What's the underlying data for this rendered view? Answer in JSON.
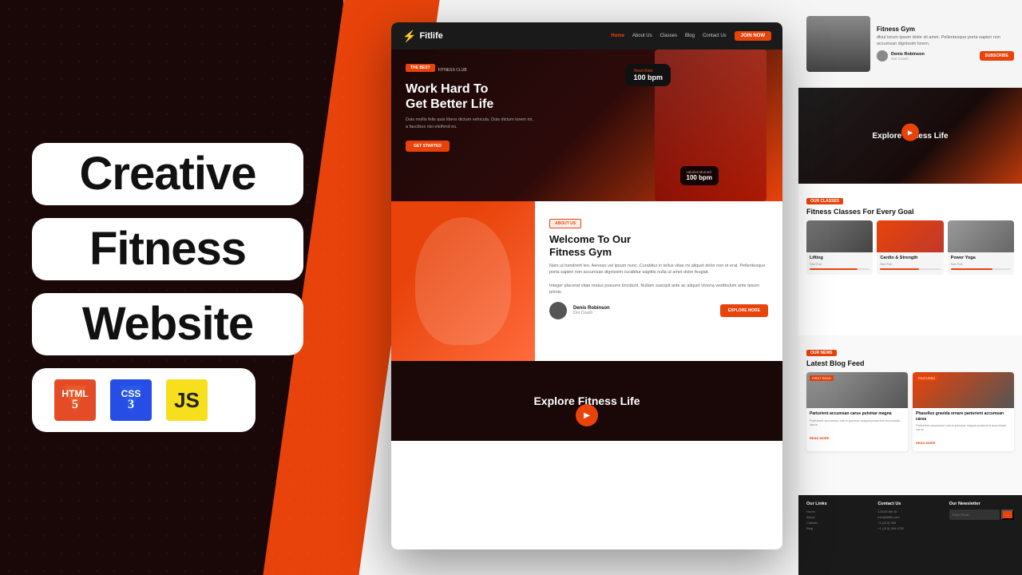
{
  "left": {
    "badge1": "Creative",
    "badge2": "Fitness",
    "badge3": "Website",
    "tech": {
      "html": "HTML5",
      "css": "CSS3",
      "js": "JS"
    }
  },
  "mockup": {
    "nav": {
      "logo": "Fitlife",
      "links": [
        "Home",
        "About Us",
        "Classes",
        "Blog",
        "Contact Us"
      ],
      "cta": "JOIN NOW"
    },
    "hero": {
      "tag1": "THE BEST",
      "tag2": "FITNESS CLUB",
      "title_line1": "Work Hard To",
      "title_line2": "Get Better Life",
      "desc": "Duis mollis felis quis libero dictum vehicula. Duis dictum lorem mi, a faucibus nisi eleifend eu.",
      "cta": "GET STARTED",
      "heart_label": "Heart Rate",
      "heart_value": "100 bpm",
      "bpm_label": "calories Burned",
      "bpm_value": "100 bpm"
    },
    "about": {
      "tag": "ABOUT US",
      "title_line1": "Welcome To Our",
      "title_line2": "Fitness Gym",
      "desc1": "Nam ut hendrerit leo. Aenean vel ipsum nunc. Curabitur in tellus vitae mi aliquet dolor non et erat. Pellentesque porta sapien non accumsan dignissim curabitur sagittis nulla ut amet dolor feugiat.",
      "desc2": "Integer placerat vitae metus posuere tincidunt. Nullam suscipit ante ac aliquet viverra vestibulum ante ipsum primis.",
      "coach_name": "Denis Robinson",
      "coach_role": "Our Coach",
      "explore_btn": "EXPLORE MORE"
    },
    "explore": {
      "title": "Explore Fitness Life"
    }
  },
  "right_panels": {
    "top": {
      "title": "Fitness Gym",
      "desc": "dkiut lorum ipsum dolor sit amet. Pellentesque porta sapien non accumsan dignissim lorem.",
      "name": "Denis Robinson",
      "role": "Our Coach",
      "btn": "SUBSCRIBE"
    },
    "explore": {
      "title": "Explore Fitness Life"
    },
    "classes": {
      "tag": "OUR CLASSES",
      "title": "Fitness Classes For Every Goal",
      "items": [
        {
          "name": "Lifting",
          "progress": 80
        },
        {
          "name": "Cardio & Strength",
          "progress": 65
        },
        {
          "name": "Power Yoga",
          "progress": 70
        }
      ]
    },
    "blog": {
      "tag": "OUR NEWS",
      "title": "Latest Blog Feed",
      "posts": [
        {
          "tag": "FIRST READ",
          "title": "Parturient accumsan carus pulvinar magna",
          "desc": "Parturient accumsan carus pulvinar magna parturient accumsan carus",
          "read_more": "READ MORE"
        },
        {
          "tag": "FEATURED",
          "title": "Phasellus gravida ornare parturient accumsan carus",
          "desc": "Parturient accumsan carus pulvinar magna parturient accumsan carus",
          "read_more": "READ MORE"
        }
      ]
    },
    "footer": {
      "cols": [
        {
          "title": "Our Links",
          "items": [
            "Home",
            "About",
            "Classes",
            "Blog"
          ]
        },
        {
          "title": "Contact Us",
          "items": [
            "123/45 6th 8th 3th",
            "info@fitlife.com",
            "+1 (213) 456",
            "+1 (213) 456 4792"
          ]
        },
        {
          "title": "Our Newsletter",
          "placeholder": "Enter Email..."
        }
      ]
    }
  }
}
